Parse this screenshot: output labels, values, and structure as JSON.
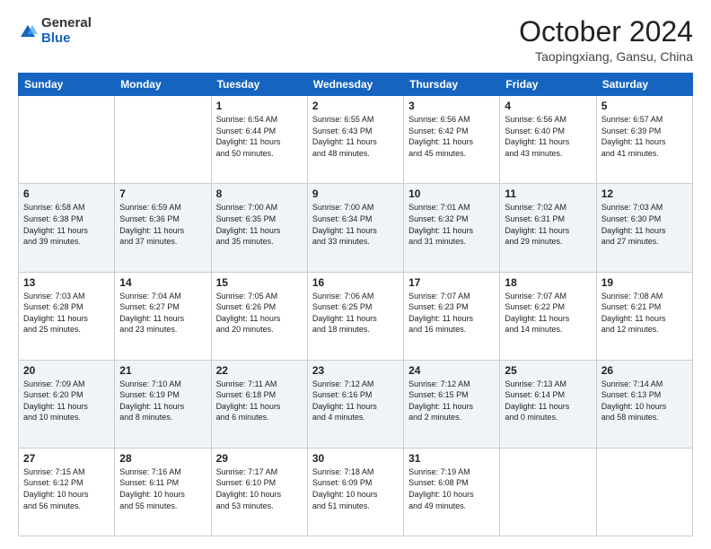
{
  "header": {
    "logo_general": "General",
    "logo_blue": "Blue",
    "month_title": "October 2024",
    "location": "Taopingxiang, Gansu, China"
  },
  "days_of_week": [
    "Sunday",
    "Monday",
    "Tuesday",
    "Wednesday",
    "Thursday",
    "Friday",
    "Saturday"
  ],
  "weeks": [
    [
      {
        "day": "",
        "detail": ""
      },
      {
        "day": "",
        "detail": ""
      },
      {
        "day": "1",
        "detail": "Sunrise: 6:54 AM\nSunset: 6:44 PM\nDaylight: 11 hours\nand 50 minutes."
      },
      {
        "day": "2",
        "detail": "Sunrise: 6:55 AM\nSunset: 6:43 PM\nDaylight: 11 hours\nand 48 minutes."
      },
      {
        "day": "3",
        "detail": "Sunrise: 6:56 AM\nSunset: 6:42 PM\nDaylight: 11 hours\nand 45 minutes."
      },
      {
        "day": "4",
        "detail": "Sunrise: 6:56 AM\nSunset: 6:40 PM\nDaylight: 11 hours\nand 43 minutes."
      },
      {
        "day": "5",
        "detail": "Sunrise: 6:57 AM\nSunset: 6:39 PM\nDaylight: 11 hours\nand 41 minutes."
      }
    ],
    [
      {
        "day": "6",
        "detail": "Sunrise: 6:58 AM\nSunset: 6:38 PM\nDaylight: 11 hours\nand 39 minutes."
      },
      {
        "day": "7",
        "detail": "Sunrise: 6:59 AM\nSunset: 6:36 PM\nDaylight: 11 hours\nand 37 minutes."
      },
      {
        "day": "8",
        "detail": "Sunrise: 7:00 AM\nSunset: 6:35 PM\nDaylight: 11 hours\nand 35 minutes."
      },
      {
        "day": "9",
        "detail": "Sunrise: 7:00 AM\nSunset: 6:34 PM\nDaylight: 11 hours\nand 33 minutes."
      },
      {
        "day": "10",
        "detail": "Sunrise: 7:01 AM\nSunset: 6:32 PM\nDaylight: 11 hours\nand 31 minutes."
      },
      {
        "day": "11",
        "detail": "Sunrise: 7:02 AM\nSunset: 6:31 PM\nDaylight: 11 hours\nand 29 minutes."
      },
      {
        "day": "12",
        "detail": "Sunrise: 7:03 AM\nSunset: 6:30 PM\nDaylight: 11 hours\nand 27 minutes."
      }
    ],
    [
      {
        "day": "13",
        "detail": "Sunrise: 7:03 AM\nSunset: 6:28 PM\nDaylight: 11 hours\nand 25 minutes."
      },
      {
        "day": "14",
        "detail": "Sunrise: 7:04 AM\nSunset: 6:27 PM\nDaylight: 11 hours\nand 23 minutes."
      },
      {
        "day": "15",
        "detail": "Sunrise: 7:05 AM\nSunset: 6:26 PM\nDaylight: 11 hours\nand 20 minutes."
      },
      {
        "day": "16",
        "detail": "Sunrise: 7:06 AM\nSunset: 6:25 PM\nDaylight: 11 hours\nand 18 minutes."
      },
      {
        "day": "17",
        "detail": "Sunrise: 7:07 AM\nSunset: 6:23 PM\nDaylight: 11 hours\nand 16 minutes."
      },
      {
        "day": "18",
        "detail": "Sunrise: 7:07 AM\nSunset: 6:22 PM\nDaylight: 11 hours\nand 14 minutes."
      },
      {
        "day": "19",
        "detail": "Sunrise: 7:08 AM\nSunset: 6:21 PM\nDaylight: 11 hours\nand 12 minutes."
      }
    ],
    [
      {
        "day": "20",
        "detail": "Sunrise: 7:09 AM\nSunset: 6:20 PM\nDaylight: 11 hours\nand 10 minutes."
      },
      {
        "day": "21",
        "detail": "Sunrise: 7:10 AM\nSunset: 6:19 PM\nDaylight: 11 hours\nand 8 minutes."
      },
      {
        "day": "22",
        "detail": "Sunrise: 7:11 AM\nSunset: 6:18 PM\nDaylight: 11 hours\nand 6 minutes."
      },
      {
        "day": "23",
        "detail": "Sunrise: 7:12 AM\nSunset: 6:16 PM\nDaylight: 11 hours\nand 4 minutes."
      },
      {
        "day": "24",
        "detail": "Sunrise: 7:12 AM\nSunset: 6:15 PM\nDaylight: 11 hours\nand 2 minutes."
      },
      {
        "day": "25",
        "detail": "Sunrise: 7:13 AM\nSunset: 6:14 PM\nDaylight: 11 hours\nand 0 minutes."
      },
      {
        "day": "26",
        "detail": "Sunrise: 7:14 AM\nSunset: 6:13 PM\nDaylight: 10 hours\nand 58 minutes."
      }
    ],
    [
      {
        "day": "27",
        "detail": "Sunrise: 7:15 AM\nSunset: 6:12 PM\nDaylight: 10 hours\nand 56 minutes."
      },
      {
        "day": "28",
        "detail": "Sunrise: 7:16 AM\nSunset: 6:11 PM\nDaylight: 10 hours\nand 55 minutes."
      },
      {
        "day": "29",
        "detail": "Sunrise: 7:17 AM\nSunset: 6:10 PM\nDaylight: 10 hours\nand 53 minutes."
      },
      {
        "day": "30",
        "detail": "Sunrise: 7:18 AM\nSunset: 6:09 PM\nDaylight: 10 hours\nand 51 minutes."
      },
      {
        "day": "31",
        "detail": "Sunrise: 7:19 AM\nSunset: 6:08 PM\nDaylight: 10 hours\nand 49 minutes."
      },
      {
        "day": "",
        "detail": ""
      },
      {
        "day": "",
        "detail": ""
      }
    ]
  ]
}
